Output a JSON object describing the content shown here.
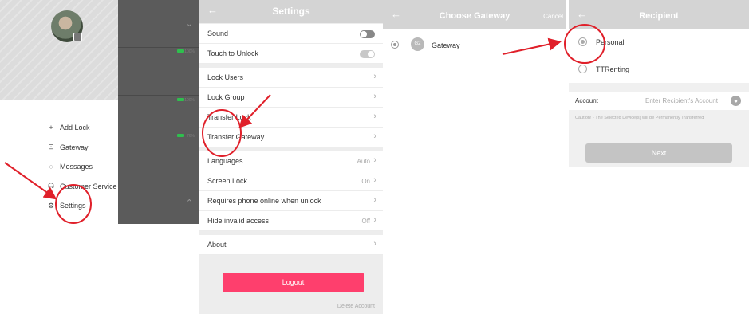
{
  "colors": {
    "accent": "#fe3f6d",
    "annotation_red": "#e0202a",
    "toggle_off": "#888888",
    "toggle_on": "#c8c8c8"
  },
  "side_menu": {
    "avatar_icon": "user-photo",
    "lock_cards": [
      {
        "battery": "100%"
      },
      {
        "battery": "100%"
      },
      {
        "battery": "76%"
      }
    ],
    "items": [
      {
        "label": "Add Lock",
        "icon": "+"
      },
      {
        "label": "Gateway",
        "icon": "⊡"
      },
      {
        "label": "Messages",
        "icon": "◌"
      },
      {
        "label": "Customer Service",
        "icon": "☊"
      },
      {
        "label": "Settings",
        "icon": "⚙"
      }
    ]
  },
  "settings": {
    "title": "Settings",
    "back_icon": "←",
    "rows": {
      "sound": "Sound",
      "touch_unlock": "Touch to Unlock",
      "lock_users": "Lock Users",
      "lock_group": "Lock Group",
      "transfer_lock": "Transfer Lock",
      "transfer_gateway": "Transfer Gateway",
      "languages": "Languages",
      "languages_value": "Auto",
      "screen_lock": "Screen Lock",
      "screen_lock_value": "On",
      "requires_online": "Requires phone online when unlock",
      "hide_invalid": "Hide invalid access",
      "hide_invalid_value": "Off",
      "about": "About"
    },
    "sound_enabled": false,
    "touch_unlock_enabled": true,
    "logout_label": "Logout",
    "delete_account_label": "Delete Account"
  },
  "choose_gateway": {
    "title": "Choose Gateway",
    "cancel_label": "Cancel",
    "gateway_badge": "G2",
    "gateway_label": "Gateway"
  },
  "recipient": {
    "title": "Recipient",
    "options": [
      "Personal",
      "TTRenting"
    ],
    "selected_option": "Personal",
    "account_label": "Account",
    "account_placeholder": "Enter Recipient's Account",
    "account_value": "",
    "caution": "Caution! - The Selected Device(s) will be Permanently Transferred",
    "next_label": "Next"
  }
}
